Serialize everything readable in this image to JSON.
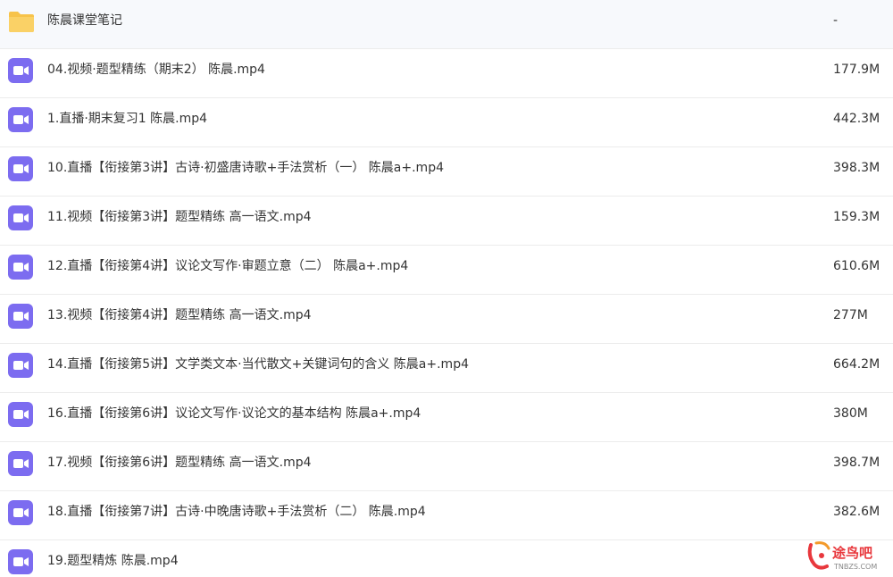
{
  "colors": {
    "folder": "#f7c34a",
    "video_icon": "#7c6cf0",
    "row_divider": "#ececec",
    "text": "#333333",
    "watermark_red": "#e8383d",
    "watermark_orange": "#f39a2b"
  },
  "files": [
    {
      "icon": "folder-icon",
      "name": "陈晨课堂笔记",
      "size": "-"
    },
    {
      "icon": "video-file-icon",
      "name": "04.视频·题型精练（期末2） 陈晨.mp4",
      "size": "177.9M"
    },
    {
      "icon": "video-file-icon",
      "name": "1.直播·期末复习1 陈晨.mp4",
      "size": "442.3M"
    },
    {
      "icon": "video-file-icon",
      "name": "10.直播【衔接第3讲】古诗·初盛唐诗歌+手法赏析（一） 陈晨a+.mp4",
      "size": "398.3M"
    },
    {
      "icon": "video-file-icon",
      "name": "11.视频【衔接第3讲】题型精练 高一语文.mp4",
      "size": "159.3M"
    },
    {
      "icon": "video-file-icon",
      "name": "12.直播【衔接第4讲】议论文写作·审题立意（二） 陈晨a+.mp4",
      "size": "610.6M"
    },
    {
      "icon": "video-file-icon",
      "name": "13.视频【衔接第4讲】题型精练 高一语文.mp4",
      "size": "277M"
    },
    {
      "icon": "video-file-icon",
      "name": "14.直播【衔接第5讲】文学类文本·当代散文+关键词句的含义 陈晨a+.mp4",
      "size": "664.2M"
    },
    {
      "icon": "video-file-icon",
      "name": "16.直播【衔接第6讲】议论文写作·议论文的基本结构 陈晨a+.mp4",
      "size": "380M"
    },
    {
      "icon": "video-file-icon",
      "name": "17.视频【衔接第6讲】题型精练 高一语文.mp4",
      "size": "398.7M"
    },
    {
      "icon": "video-file-icon",
      "name": "18.直播【衔接第7讲】古诗·中晚唐诗歌+手法赏析（二） 陈晨.mp4",
      "size": "382.6M"
    },
    {
      "icon": "video-file-icon",
      "name": "19.题型精炼 陈晨.mp4",
      "size": ""
    }
  ],
  "watermark": {
    "brand_text": "途鸟吧",
    "sub_text": "TNBZS.COM"
  }
}
